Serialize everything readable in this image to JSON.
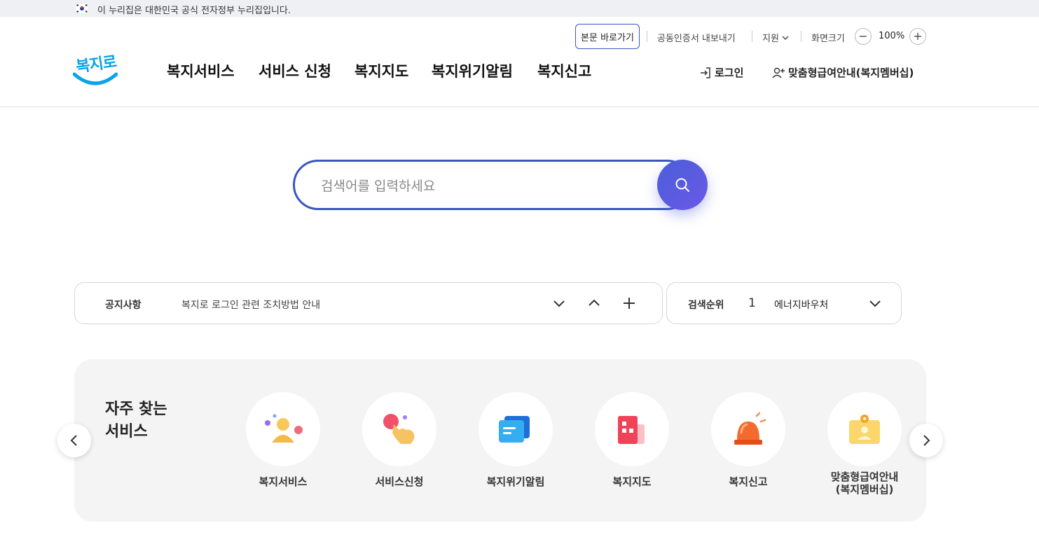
{
  "gov_banner": {
    "text": "이 누리집은 대한민국 공식 전자정부 누리집입니다.",
    "flag_icon": "korea-flag-icon"
  },
  "utility": {
    "skip_label": "본문 바로가기",
    "cert_label": "공동인증서 내보내기",
    "support_label": "지원",
    "zoom_label": "화면크기",
    "zoom_value": "100%",
    "zoom_out": "−",
    "zoom_in": "+"
  },
  "logo": {
    "text": "복지로",
    "color": "#0aa3e8"
  },
  "gnb": [
    "복지서비스",
    "서비스 신청",
    "복지지도",
    "복지위기알림",
    "복지신고"
  ],
  "account": {
    "login_label": "로그인",
    "membership_label": "맞춤형급여안내(복지멤버십)"
  },
  "search": {
    "placeholder": "검색어를 입력하세요",
    "value": "",
    "accent": "#3b55c2"
  },
  "notice": {
    "label": "공지사항",
    "text": "복지로 로그인 관련 조치방법 안내",
    "plus": "+"
  },
  "rank": {
    "label": "검색순위",
    "number": "1",
    "keyword": "에너지바우처"
  },
  "favorites": {
    "title_line1": "자주 찾는",
    "title_line2": "서비스",
    "items": [
      {
        "label": "복지서비스",
        "icon": "person-service-icon"
      },
      {
        "label": "서비스신청",
        "icon": "hand-tap-icon"
      },
      {
        "label": "복지위기알림",
        "icon": "message-alert-icon"
      },
      {
        "label": "복지지도",
        "icon": "map-building-icon"
      },
      {
        "label": "복지신고",
        "icon": "siren-icon"
      },
      {
        "label_line1": "맞춤형급여안내",
        "label_line2": "(복지멤버십)",
        "icon": "id-badge-icon"
      }
    ]
  }
}
